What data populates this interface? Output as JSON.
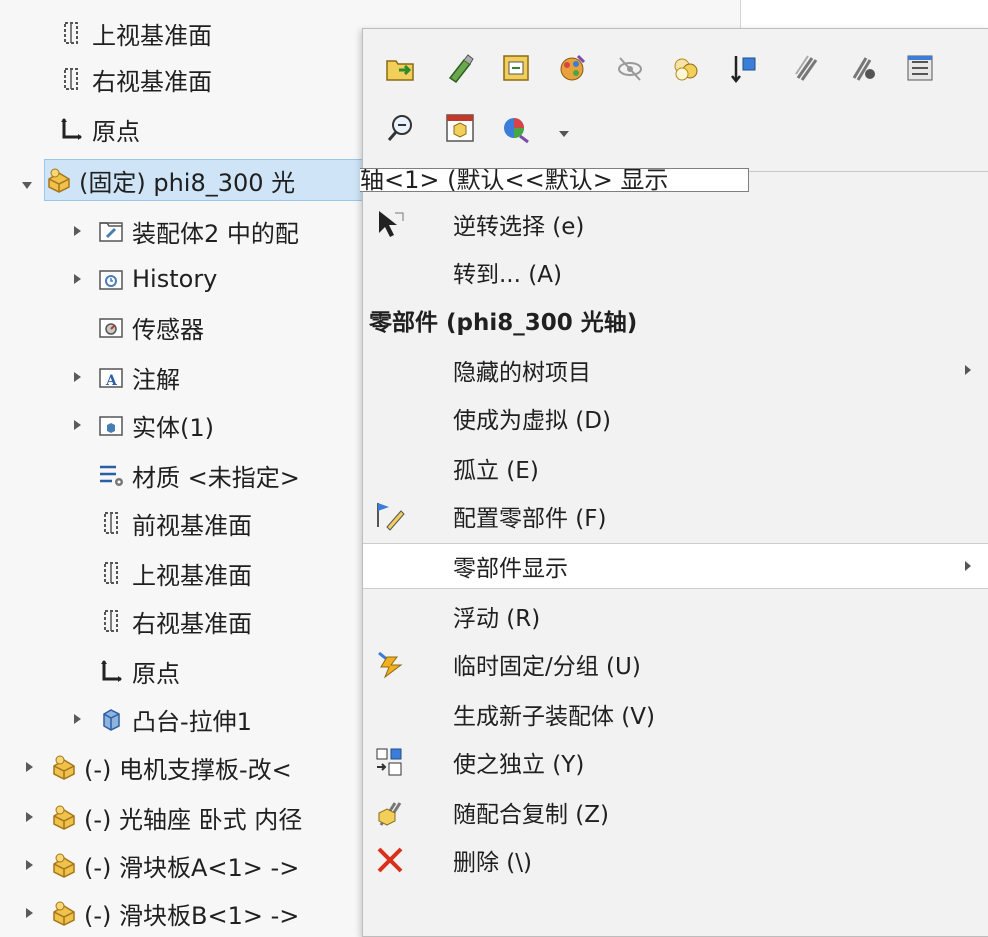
{
  "tree": {
    "rows": [
      {
        "label": "上视基准面",
        "icon": "plane-icon"
      },
      {
        "label": "右视基准面",
        "icon": "plane-icon"
      },
      {
        "label": "原点",
        "icon": "origin-icon"
      },
      {
        "label": "(固定) phi8_300 光",
        "icon": "part-icon"
      },
      {
        "label": "装配体2 中的配",
        "icon": "folder-mates-icon"
      },
      {
        "label": "History",
        "icon": "folder-history-icon"
      },
      {
        "label": "传感器",
        "icon": "folder-sensor-icon"
      },
      {
        "label": "注解",
        "icon": "folder-annotation-icon"
      },
      {
        "label": "实体(1)",
        "icon": "folder-solid-icon"
      },
      {
        "label": "材质 <未指定>",
        "icon": "material-icon"
      },
      {
        "label": "前视基准面",
        "icon": "plane-icon"
      },
      {
        "label": "上视基准面",
        "icon": "plane-icon"
      },
      {
        "label": "右视基准面",
        "icon": "plane-icon"
      },
      {
        "label": "原点",
        "icon": "origin-icon"
      },
      {
        "label": "凸台-拉伸1",
        "icon": "extrude-icon"
      },
      {
        "label": "(-) 电机支撑板-改<",
        "icon": "part-icon"
      },
      {
        "label": "(-) 光轴座 卧式 内径",
        "icon": "part-icon"
      },
      {
        "label": "(-) 滑块板A<1> ->",
        "icon": "part-icon"
      },
      {
        "label": "(-) 滑块板B<1> ->",
        "icon": "part-icon"
      }
    ],
    "name_field_text": "轴<1> (默认<<默认> 显示"
  },
  "toolbar": {
    "row1_icons": [
      "open-part-icon",
      "edit-part-icon",
      "edit-assembly-icon",
      "appearance-icon",
      "hide-icon",
      "change-transparency-icon",
      "move-component-icon",
      "mate-icon",
      "smart-mate-icon",
      "properties-icon"
    ],
    "row2_icons": [
      "zoom-to-selection-icon",
      "view-icon",
      "color-icon"
    ]
  },
  "menu": {
    "items": [
      {
        "label": "逆转选择 (e)",
        "icon": "cursor-icon"
      },
      {
        "label": "转到... (A)",
        "icon": ""
      },
      {
        "label": "零部件 (phi8_300 光轴)",
        "icon": "",
        "header": true
      },
      {
        "label": "隐藏的树项目",
        "icon": "",
        "submenu": true
      },
      {
        "label": "使成为虚拟 (D)",
        "icon": ""
      },
      {
        "label": "孤立 (E)",
        "icon": ""
      },
      {
        "label": "配置零部件 (F)",
        "icon": "configure-component-icon"
      },
      {
        "label": "零部件显示",
        "icon": "",
        "submenu": true,
        "highlighted": true
      },
      {
        "label": "浮动 (R)",
        "icon": ""
      },
      {
        "label": "临时固定/分组 (U)",
        "icon": "fix-group-icon"
      },
      {
        "label": "生成新子装配体 (V)",
        "icon": ""
      },
      {
        "label": "使之独立 (Y)",
        "icon": "make-independent-icon"
      },
      {
        "label": "随配合复制 (Z)",
        "icon": "copy-with-mates-icon"
      },
      {
        "label": "删除 (\\)",
        "icon": "delete-icon"
      }
    ]
  },
  "colors": {
    "selection": "#cfe5f7",
    "delete_red": "#d9301c",
    "part_yellow": "#e9b43c"
  }
}
